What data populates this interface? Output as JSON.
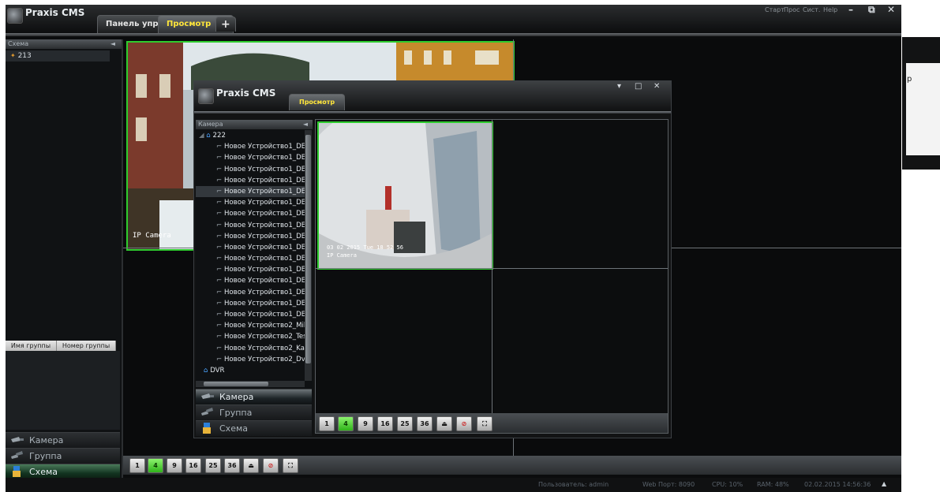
{
  "app": {
    "title": "Praxis CMS"
  },
  "tabs": [
    {
      "label": "Панель управ",
      "active": false
    },
    {
      "label": "Просмотр",
      "active": true,
      "close": "×"
    },
    {
      "label": "+",
      "active": false
    }
  ],
  "menu": {
    "start": "Старт",
    "view": "Прос",
    "system": "Сист.",
    "help": "Help"
  },
  "window_controls": {
    "minimize": "–",
    "maximize": "⧉",
    "close": "✕"
  },
  "left_panel": {
    "header": "Схема",
    "collapse_glyph": "◄",
    "tree": [
      {
        "label": "213"
      }
    ],
    "group_columns": [
      "Имя группы",
      "Номер группы"
    ],
    "nav": [
      {
        "label": "Камера",
        "icon": "camera-icon",
        "selected": false
      },
      {
        "label": "Группа",
        "icon": "group-icon",
        "selected": false
      },
      {
        "label": "Схема",
        "icon": "scheme-icon",
        "selected": true
      }
    ]
  },
  "view": {
    "camera_overlay": "IP Camera"
  },
  "toolbar": [
    {
      "name": "layout-1",
      "label": "1"
    },
    {
      "name": "layout-4",
      "label": "4",
      "active": true
    },
    {
      "name": "layout-9",
      "label": "9"
    },
    {
      "name": "layout-16",
      "label": "16"
    },
    {
      "name": "layout-25",
      "label": "25"
    },
    {
      "name": "layout-36",
      "label": "36"
    },
    {
      "name": "eject",
      "label": "⏏"
    },
    {
      "name": "stop-all",
      "label": "⊘"
    },
    {
      "name": "fullscreen",
      "label": "⛶"
    }
  ],
  "status_bar": {
    "user": "Пользователь: admin",
    "web_port": "Web Порт: 8090",
    "cpu": "CPU: 10%",
    "ram": "RAM: 48%",
    "datetime": "02.02.2015 14:56:36",
    "arrow": "▲"
  },
  "inner_window": {
    "title": "Praxis CMS",
    "tab": "Просмотр",
    "controls": {
      "minimize": "▾",
      "maximize": "□",
      "close": "✕"
    },
    "panel_header": "Камера",
    "collapse_glyph": "◄",
    "root": "222",
    "devices": [
      "Новое Устройство1_DEVIC",
      "Новое Устройство1_DEVIC",
      "Новое Устройство1_DEVIC",
      "Новое Устройство1_DEVIC",
      "Новое Устройство1_DEVIC",
      "Новое Устройство1_DEVIC",
      "Новое Устройство1_DEVIC",
      "Новое Устройство1_DEVIC",
      "Новое Устройство1_DEVIC",
      "Новое Устройство1_DEVIC",
      "Новое Устройство1_DEVIC",
      "Новое Устройство1_DEVIC",
      "Новое Устройство1_DEVIC",
      "Новое Устройство1_DEVIC",
      "Новое Устройство1_DEVIC",
      "Новое Устройство1_DEVIC",
      "Новое Устройство2_Mikro",
      "Новое Устройство2_Test",
      "Новое Устройство2_Kabin",
      "Новое Устройство2_Dvor"
    ],
    "second_root": "DVR",
    "nav": [
      {
        "label": "Камера",
        "selected": true
      },
      {
        "label": "Группа",
        "selected": false
      },
      {
        "label": "Схема",
        "selected": false
      }
    ],
    "camera_timestamp": "03 02 2015 Tue 18 52 56",
    "camera_overlay": "IP Camera"
  },
  "dialog_fragment": {
    "text": "р"
  }
}
